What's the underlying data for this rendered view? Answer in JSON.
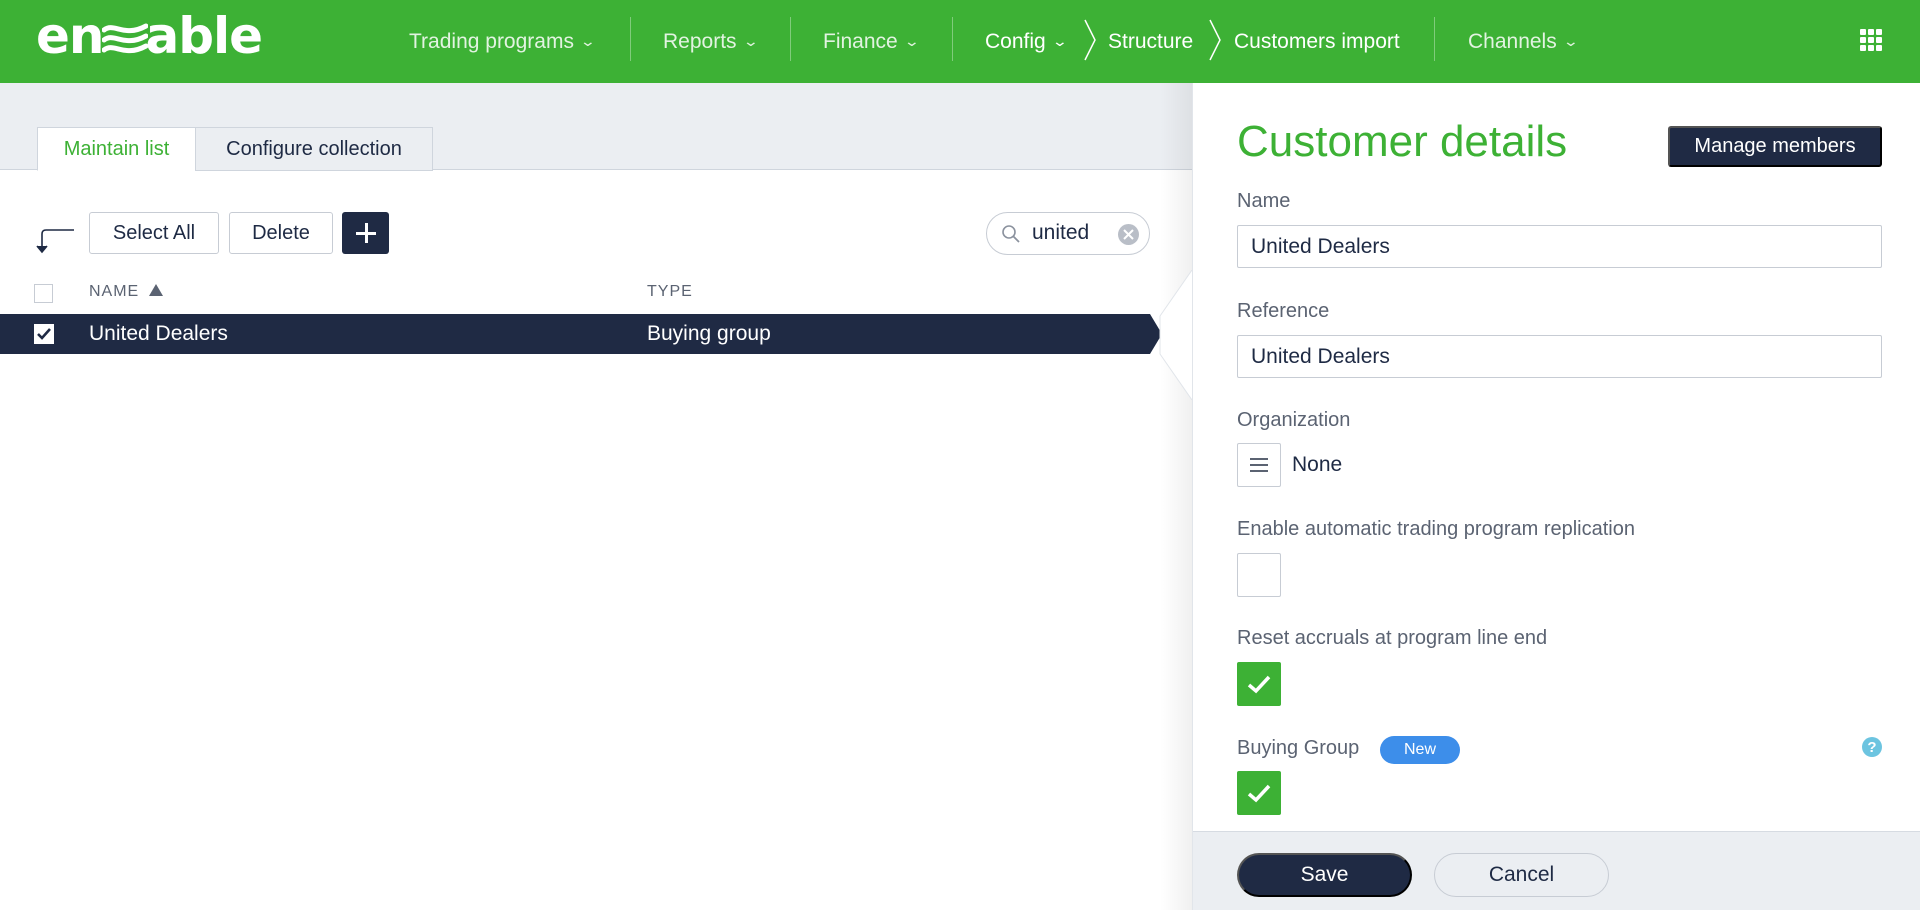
{
  "app": {
    "logo_text_left": "en",
    "logo_text_right": "able"
  },
  "nav": {
    "trading_programs": "Trading programs",
    "reports": "Reports",
    "finance": "Finance",
    "config": "Config",
    "structure": "Structure",
    "customers_import": "Customers import",
    "channels": "Channels"
  },
  "tabs": {
    "maintain_list": "Maintain list",
    "configure_collection": "Configure collection"
  },
  "toolbar": {
    "select_all": "Select All",
    "delete": "Delete"
  },
  "search": {
    "value": "united"
  },
  "table": {
    "columns": {
      "name": "NAME",
      "type": "TYPE"
    },
    "rows": [
      {
        "name": "United Dealers",
        "type": "Buying group",
        "checked": true
      }
    ]
  },
  "panel": {
    "title": "Customer details",
    "manage_members": "Manage members",
    "name_label": "Name",
    "name_value": "United Dealers",
    "reference_label": "Reference",
    "reference_value": "United Dealers",
    "organization_label": "Organization",
    "organization_value": "None",
    "replication_label": "Enable automatic trading program replication",
    "replication_checked": false,
    "reset_accruals_label": "Reset accruals at program line end",
    "reset_accruals_checked": true,
    "buying_group_label": "Buying Group",
    "buying_group_badge": "New",
    "buying_group_checked": true,
    "help_glyph": "?",
    "save": "Save",
    "cancel": "Cancel"
  },
  "colors": {
    "brand_green": "#3db135",
    "navy": "#1f2a44",
    "badge_blue": "#3d8eea",
    "help_blue": "#6cc4e0"
  }
}
